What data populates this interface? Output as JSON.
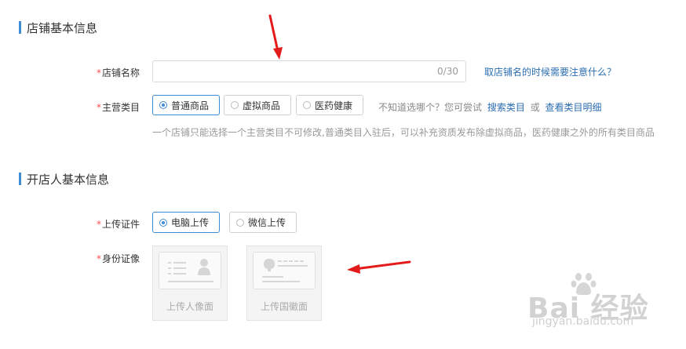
{
  "store_section": {
    "title": "店铺基本信息",
    "name_label": "店铺名称",
    "name_value": "",
    "name_counter": "0/30",
    "name_tip": "取店铺名的时候需要注意什么？",
    "category_label": "主营类目",
    "categories": [
      {
        "label": "普通商品",
        "selected": true
      },
      {
        "label": "虚拟商品",
        "selected": false
      },
      {
        "label": "医药健康",
        "selected": false
      }
    ],
    "hint_prefix": "不知道选哪个？您可尝试",
    "hint_link1": "搜索类目",
    "hint_or": "或",
    "hint_link2": "查看类目明细",
    "note": "一个店铺只能选择一个主营类目不可修改,普通类目入驻后，可以补充资质发布除虚拟商品，医药健康之外的所有类目商品"
  },
  "owner_section": {
    "title": "开店人基本信息",
    "upload_label": "上传证件",
    "upload_options": [
      {
        "label": "电脑上传",
        "selected": true
      },
      {
        "label": "微信上传",
        "selected": false
      }
    ],
    "id_label": "身份证像",
    "id_cards": [
      {
        "caption": "上传人像面",
        "icon": "id-portrait-side-icon"
      },
      {
        "caption": "上传国徽面",
        "icon": "id-emblem-side-icon"
      }
    ]
  },
  "required_mark": "*",
  "watermark": {
    "text": "Bai 经验",
    "url": "jingyan.baidu.com"
  },
  "colors": {
    "accent": "#3e8bd6",
    "required": "#ff4d4d",
    "link": "#2b6db0",
    "arrow": "#e31b1b"
  }
}
